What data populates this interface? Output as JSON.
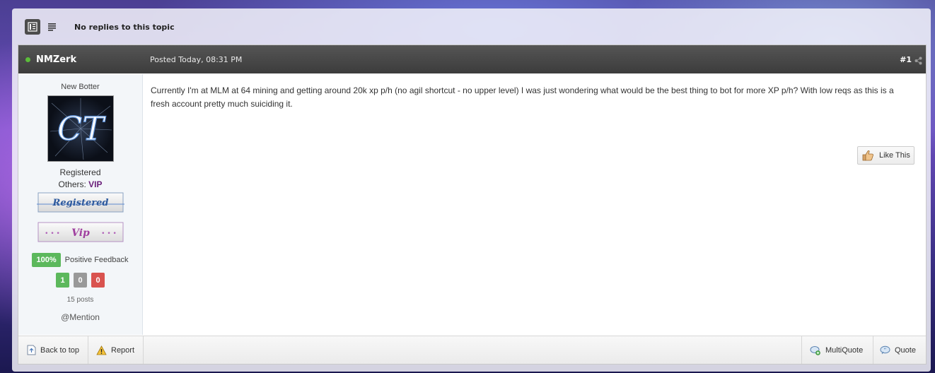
{
  "topic": {
    "no_replies_label": "No replies to this topic"
  },
  "post": {
    "author": "NMZerk",
    "posted": "Posted Today, 08:31 PM",
    "number": "#1",
    "member_title": "New Botter",
    "group_primary": "Registered",
    "group_other_prefix": "Others: ",
    "group_other_value": "VIP",
    "badge1_text": "Registered",
    "badge2_text": "Vip",
    "avatar_text": "CT",
    "feedback": {
      "percent": "100%",
      "label": "Positive Feedback",
      "positive": "1",
      "neutral": "0",
      "negative": "0"
    },
    "post_count": "15 posts",
    "mention": "@Mention",
    "content": "Currently I'm at MLM at 64 mining and getting around 20k xp p/h (no agil shortcut - no upper level) I was just wondering what would be the best thing to bot for more XP p/h? With low reqs as this is a fresh account pretty much suiciding it.",
    "like_label": "Like This"
  },
  "footer": {
    "back_to_top": "Back to top",
    "report": "Report",
    "multiquote": "MultiQuote",
    "quote": "Quote"
  },
  "colors": {
    "online": "#5bbd3a",
    "feedback_positive": "#5cb85c",
    "feedback_neutral": "#999999",
    "feedback_negative": "#d9534f",
    "vip": "#6a1f7a"
  }
}
